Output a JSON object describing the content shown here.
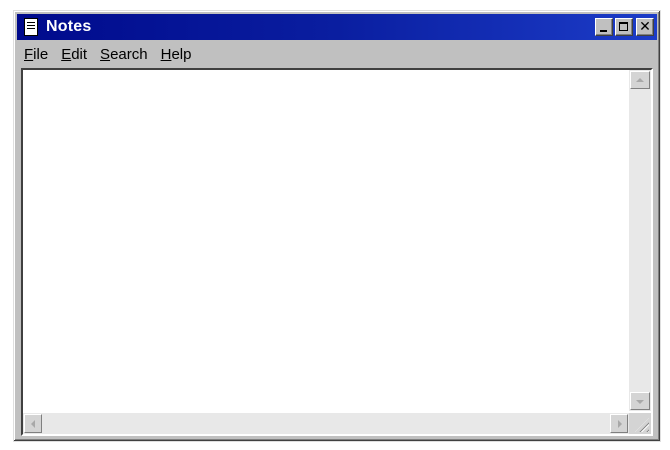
{
  "window": {
    "title": "Notes",
    "title_icon": "notepad-icon",
    "controls": {
      "minimize_icon": "minimize-icon",
      "maximize_icon": "maximize-icon",
      "close_glyph": "✕"
    },
    "title_colors": [
      "#000a8c",
      "#1c3cc8"
    ]
  },
  "menubar": {
    "items": [
      {
        "mnemonic": "F",
        "rest": "ile"
      },
      {
        "mnemonic": "E",
        "rest": "dit"
      },
      {
        "mnemonic": "S",
        "rest": "earch"
      },
      {
        "mnemonic": "H",
        "rest": "elp"
      }
    ]
  },
  "editor": {
    "text": ""
  },
  "scrollbars": {
    "up_icon": "arrow-up-icon",
    "down_icon": "arrow-down-icon",
    "left_icon": "arrow-left-icon",
    "right_icon": "arrow-right-icon",
    "grip_icon": "size-grip-icon"
  }
}
